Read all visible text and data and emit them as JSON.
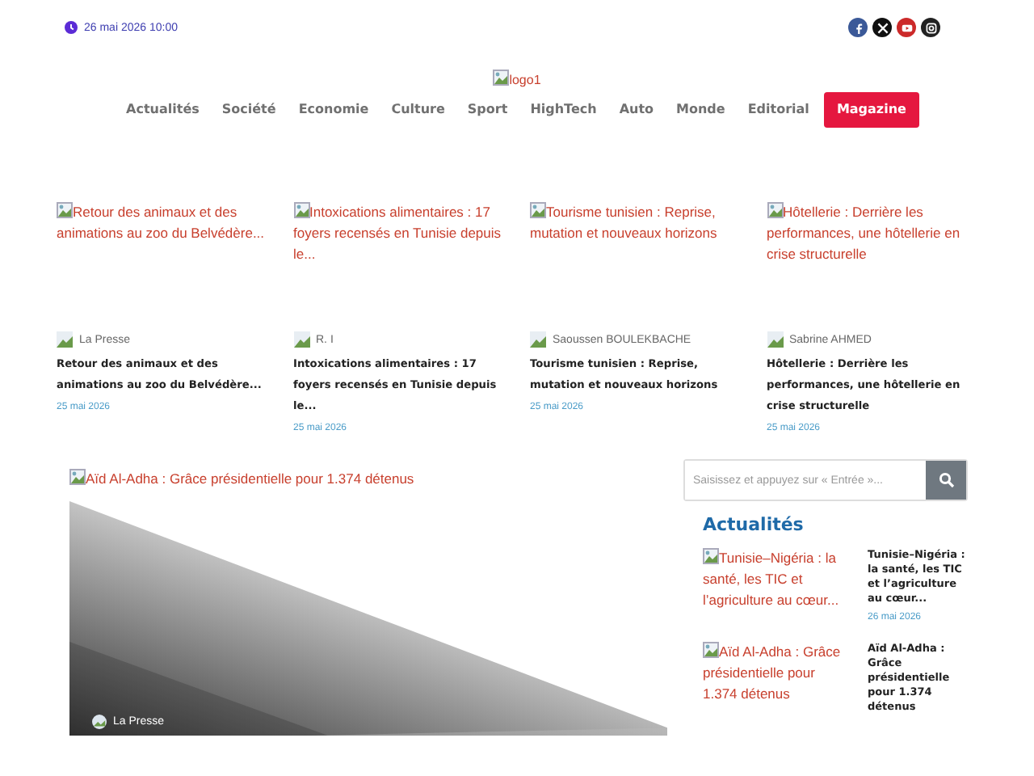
{
  "topbar": {
    "date": "26 mai 2026 10:00",
    "social": [
      {
        "kind": "facebook",
        "color": "#3b5998"
      },
      {
        "kind": "x",
        "color": "#111111"
      },
      {
        "kind": "youtube",
        "color": "#cc2a2a"
      },
      {
        "kind": "instagram",
        "color": "#222222"
      }
    ]
  },
  "logo": {
    "alt": "logo1"
  },
  "nav": [
    {
      "label": "Actualités",
      "selected": false
    },
    {
      "label": "Société",
      "selected": false
    },
    {
      "label": "Economie",
      "selected": false
    },
    {
      "label": "Culture",
      "selected": false
    },
    {
      "label": "Sport",
      "selected": false
    },
    {
      "label": "HighTech",
      "selected": false
    },
    {
      "label": "Auto",
      "selected": false
    },
    {
      "label": "Monde",
      "selected": false
    },
    {
      "label": "Editorial",
      "selected": false
    },
    {
      "label": "Magazine",
      "selected": true
    }
  ],
  "cards": [
    {
      "image_alt": "Retour des animaux et des animations au zoo du Belvédère...",
      "author": "La Presse",
      "title": "Retour des animaux et des animations au zoo du Belvédère...",
      "date": "25 mai 2026"
    },
    {
      "image_alt": "Intoxications alimentaires : 17 foyers recensés en Tunisie depuis le...",
      "author": "R. I",
      "title": "Intoxications alimentaires : 17 foyers recensés en Tunisie depuis le...",
      "date": "25 mai 2026"
    },
    {
      "image_alt": "Tourisme tunisien : Reprise, mutation et nouveaux horizons",
      "author": "Saoussen BOULEKBACHE",
      "title": "Tourisme tunisien : Reprise, mutation et nouveaux horizons",
      "date": "25 mai 2026"
    },
    {
      "image_alt": "Hôtellerie : Derrière les performances, une hôtellerie en crise structurelle",
      "author": "Sabrine AHMED",
      "title": "Hôtellerie : Derrière les performances, une hôtellerie en crise structurelle",
      "date": "25 mai 2026"
    }
  ],
  "featured": {
    "image_alt": "Aïd Al-Adha : Grâce présidentielle pour 1.374 détenus",
    "author": "La Presse"
  },
  "sidebar": {
    "search": {
      "placeholder": "Saisissez et appuyez sur « Entrée »..."
    },
    "heading": "Actualités",
    "items": [
      {
        "image_alt": "Tunisie–Nigéria : la santé, les TIC et l’agriculture au cœur...",
        "title": "Tunisie–Nigéria : la santé, les TIC et l’agriculture au cœur...",
        "date": "26 mai 2026"
      },
      {
        "image_alt": "Aïd Al-Adha : Grâce présidentielle pour 1.374 détenus",
        "title": "Aïd Al-Adha : Grâce présidentielle pour 1.374 détenus"
      }
    ]
  }
}
